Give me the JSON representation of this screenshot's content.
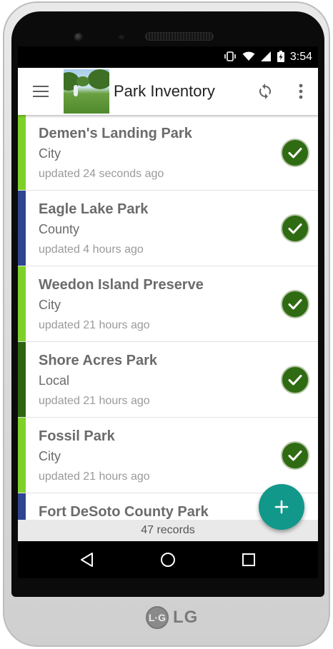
{
  "device": {
    "brand": "LG"
  },
  "status_bar": {
    "time": "3:54",
    "icons": [
      "vibrate-icon",
      "wifi-icon",
      "signal-icon",
      "battery-charging-icon"
    ]
  },
  "app_bar": {
    "title": "Park Inventory",
    "menu_icon": "menu-icon",
    "sync_icon": "sync-icon",
    "overflow_icon": "more-vert-icon"
  },
  "records": [
    {
      "name": "Demen's Landing Park",
      "type": "City",
      "updated": "updated 24 seconds ago",
      "color": "#7fd12a",
      "synced": true
    },
    {
      "name": "Eagle Lake Park",
      "type": "County",
      "updated": "updated 4 hours ago",
      "color": "#2f4592",
      "synced": true
    },
    {
      "name": "Weedon Island Preserve",
      "type": "City",
      "updated": "updated 21 hours ago",
      "color": "#7fd12a",
      "synced": true
    },
    {
      "name": "Shore Acres Park",
      "type": "Local",
      "updated": "updated 21 hours ago",
      "color": "#2e6410",
      "synced": true
    },
    {
      "name": "Fossil Park",
      "type": "City",
      "updated": "updated 21 hours ago",
      "color": "#7fd12a",
      "synced": true
    },
    {
      "name": "Fort DeSoto County Park",
      "type": "",
      "updated": "",
      "color": "#2f4592",
      "synced": false
    }
  ],
  "footer": {
    "count_text": "47 records"
  },
  "fab": {
    "icon": "add-icon",
    "label": "+"
  },
  "nav_bar": {
    "back_icon": "back-icon",
    "home_icon": "home-icon",
    "recents_icon": "recents-icon"
  }
}
